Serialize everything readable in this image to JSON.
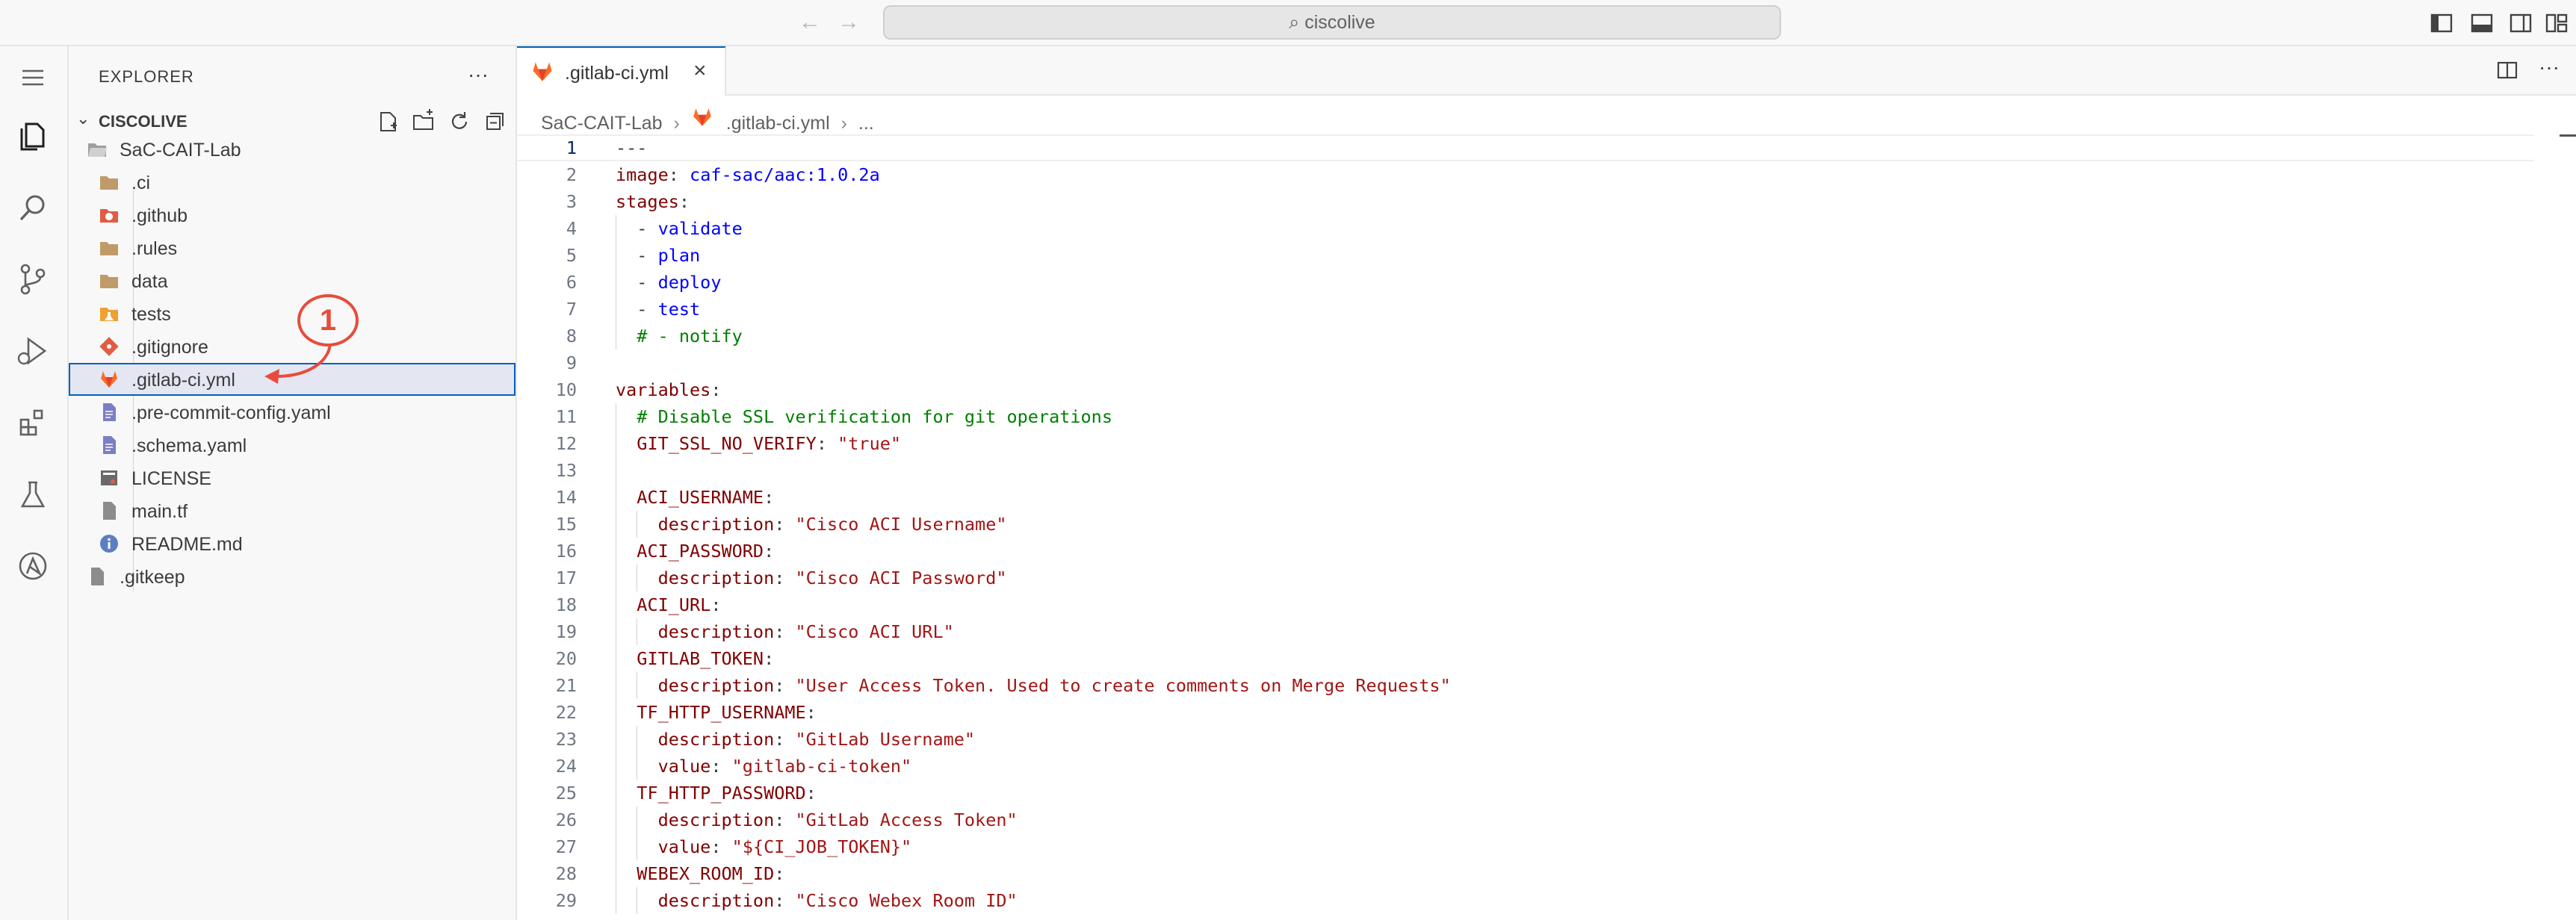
{
  "titlebar": {
    "search_text": "ciscolive",
    "back_icon": "arrow-left-icon",
    "forward_icon": "arrow-right-icon"
  },
  "activity_bar": {
    "items": [
      "menu-icon",
      "explorer-icon",
      "search-icon",
      "source-control-icon",
      "run-debug-icon",
      "extensions-icon",
      "testing-icon",
      "ansible-icon"
    ]
  },
  "explorer": {
    "title": "EXPLORER",
    "more": "···",
    "workspace": "CISCOLIVE",
    "items": [
      {
        "label": "SaC-CAIT-Lab",
        "icon": "folder-open-icon"
      },
      {
        "label": ".ci",
        "icon": "folder-icon"
      },
      {
        "label": ".github",
        "icon": "github-folder-icon"
      },
      {
        "label": ".rules",
        "icon": "folder-icon"
      },
      {
        "label": "data",
        "icon": "folder-icon"
      },
      {
        "label": "tests",
        "icon": "tests-folder-icon"
      },
      {
        "label": ".gitignore",
        "icon": "git-icon"
      },
      {
        "label": ".gitlab-ci.yml",
        "icon": "gitlab-icon"
      },
      {
        "label": ".pre-commit-config.yaml",
        "icon": "yaml-file-icon"
      },
      {
        "label": ".schema.yaml",
        "icon": "yaml-file-icon"
      },
      {
        "label": "LICENSE",
        "icon": "license-icon"
      },
      {
        "label": "main.tf",
        "icon": "file-icon"
      },
      {
        "label": "README.md",
        "icon": "info-icon"
      },
      {
        "label": ".gitkeep",
        "icon": "file-icon"
      }
    ],
    "selected": ".gitlab-ci.yml"
  },
  "editor": {
    "tab_label": ".gitlab-ci.yml",
    "close": "×",
    "more": "···",
    "breadcrumb": {
      "folder": "SaC-CAIT-Lab",
      "file": ".gitlab-ci.yml",
      "tail": "..."
    },
    "current_line": 1,
    "lines": [
      {
        "n": "1",
        "parts": [
          {
            "t": "---",
            "c": "p"
          }
        ]
      },
      {
        "n": "2",
        "parts": [
          {
            "t": "image",
            "c": "k"
          },
          {
            "t": ": ",
            "c": "p"
          },
          {
            "t": "caf-sac/aac:1.0.2a",
            "c": "b"
          }
        ]
      },
      {
        "n": "3",
        "parts": [
          {
            "t": "stages",
            "c": "k"
          },
          {
            "t": ":",
            "c": "p"
          }
        ]
      },
      {
        "n": "4",
        "parts": [
          {
            "t": "  - ",
            "c": "p"
          },
          {
            "t": "validate",
            "c": "b"
          }
        ]
      },
      {
        "n": "5",
        "parts": [
          {
            "t": "  - ",
            "c": "p"
          },
          {
            "t": "plan",
            "c": "b"
          }
        ]
      },
      {
        "n": "6",
        "parts": [
          {
            "t": "  - ",
            "c": "p"
          },
          {
            "t": "deploy",
            "c": "b"
          }
        ]
      },
      {
        "n": "7",
        "parts": [
          {
            "t": "  - ",
            "c": "p"
          },
          {
            "t": "test",
            "c": "b"
          }
        ]
      },
      {
        "n": "8",
        "parts": [
          {
            "t": "  # - notify",
            "c": "c"
          }
        ]
      },
      {
        "n": "9",
        "parts": []
      },
      {
        "n": "10",
        "parts": [
          {
            "t": "variables",
            "c": "k"
          },
          {
            "t": ":",
            "c": "p"
          }
        ]
      },
      {
        "n": "11",
        "parts": [
          {
            "t": "  # Disable SSL verification for git operations",
            "c": "c"
          }
        ]
      },
      {
        "n": "12",
        "parts": [
          {
            "t": "  GIT_SSL_NO_VERIFY",
            "c": "k"
          },
          {
            "t": ": ",
            "c": "p"
          },
          {
            "t": "\"true\"",
            "c": "s"
          }
        ]
      },
      {
        "n": "13",
        "parts": []
      },
      {
        "n": "14",
        "parts": [
          {
            "t": "  ACI_USERNAME",
            "c": "k"
          },
          {
            "t": ":",
            "c": "p"
          }
        ]
      },
      {
        "n": "15",
        "parts": [
          {
            "t": "    description",
            "c": "k"
          },
          {
            "t": ": ",
            "c": "p"
          },
          {
            "t": "\"Cisco ACI Username\"",
            "c": "s"
          }
        ]
      },
      {
        "n": "16",
        "parts": [
          {
            "t": "  ACI_PASSWORD",
            "c": "k"
          },
          {
            "t": ":",
            "c": "p"
          }
        ]
      },
      {
        "n": "17",
        "parts": [
          {
            "t": "    description",
            "c": "k"
          },
          {
            "t": ": ",
            "c": "p"
          },
          {
            "t": "\"Cisco ACI Password\"",
            "c": "s"
          }
        ]
      },
      {
        "n": "18",
        "parts": [
          {
            "t": "  ACI_URL",
            "c": "k"
          },
          {
            "t": ":",
            "c": "p"
          }
        ]
      },
      {
        "n": "19",
        "parts": [
          {
            "t": "    description",
            "c": "k"
          },
          {
            "t": ": ",
            "c": "p"
          },
          {
            "t": "\"Cisco ACI URL\"",
            "c": "s"
          }
        ]
      },
      {
        "n": "20",
        "parts": [
          {
            "t": "  GITLAB_TOKEN",
            "c": "k"
          },
          {
            "t": ":",
            "c": "p"
          }
        ]
      },
      {
        "n": "21",
        "parts": [
          {
            "t": "    description",
            "c": "k"
          },
          {
            "t": ": ",
            "c": "p"
          },
          {
            "t": "\"User Access Token. Used to create comments on Merge Requests\"",
            "c": "s"
          }
        ]
      },
      {
        "n": "22",
        "parts": [
          {
            "t": "  TF_HTTP_USERNAME",
            "c": "k"
          },
          {
            "t": ":",
            "c": "p"
          }
        ]
      },
      {
        "n": "23",
        "parts": [
          {
            "t": "    description",
            "c": "k"
          },
          {
            "t": ": ",
            "c": "p"
          },
          {
            "t": "\"GitLab Username\"",
            "c": "s"
          }
        ]
      },
      {
        "n": "24",
        "parts": [
          {
            "t": "    value",
            "c": "k"
          },
          {
            "t": ": ",
            "c": "p"
          },
          {
            "t": "\"gitlab-ci-token\"",
            "c": "s"
          }
        ]
      },
      {
        "n": "25",
        "parts": [
          {
            "t": "  TF_HTTP_PASSWORD",
            "c": "k"
          },
          {
            "t": ":",
            "c": "p"
          }
        ]
      },
      {
        "n": "26",
        "parts": [
          {
            "t": "    description",
            "c": "k"
          },
          {
            "t": ": ",
            "c": "p"
          },
          {
            "t": "\"GitLab Access Token\"",
            "c": "s"
          }
        ]
      },
      {
        "n": "27",
        "parts": [
          {
            "t": "    value",
            "c": "k"
          },
          {
            "t": ": ",
            "c": "p"
          },
          {
            "t": "\"${CI_JOB_TOKEN}\"",
            "c": "s"
          }
        ]
      },
      {
        "n": "28",
        "parts": [
          {
            "t": "  WEBEX_ROOM_ID",
            "c": "k"
          },
          {
            "t": ":",
            "c": "p"
          }
        ]
      },
      {
        "n": "29",
        "parts": [
          {
            "t": "    description",
            "c": "k"
          },
          {
            "t": ": ",
            "c": "p"
          },
          {
            "t": "\"Cisco Webex Room ID\"",
            "c": "s"
          }
        ]
      }
    ]
  },
  "annotation": {
    "number": "1"
  },
  "colors": {
    "accent": "#005fb8",
    "selection": "#e4e6f1",
    "callout": "#e74c3c"
  }
}
